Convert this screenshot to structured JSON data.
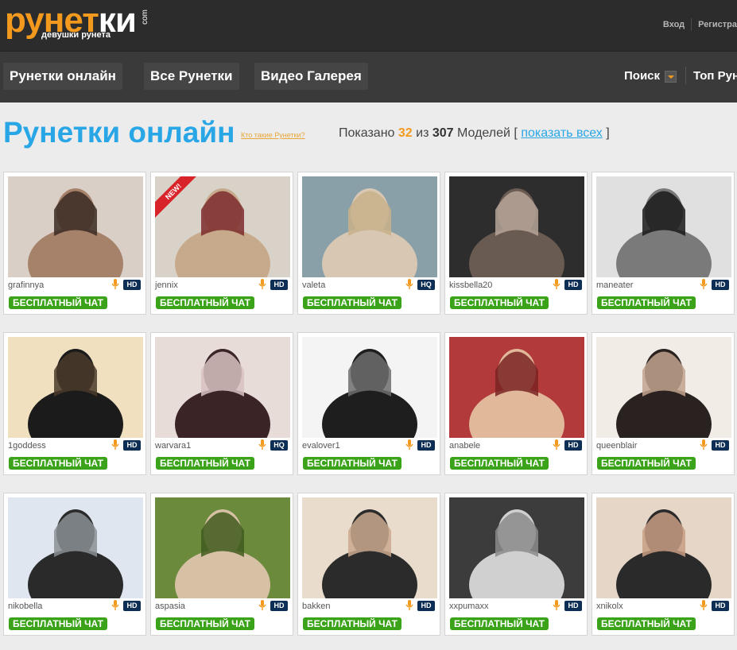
{
  "logo": {
    "main_orange": "рунет",
    "main_white": "ки",
    "domain": "com",
    "subtitle": "девушки рунета"
  },
  "auth": {
    "login": "Вход",
    "register": "Регистра"
  },
  "nav": {
    "items": [
      "Рунетки онлайн",
      "Все Рунетки",
      "Видео Галерея"
    ],
    "search": "Поиск",
    "top": "Топ Рун"
  },
  "heading": {
    "title": "Рунетки онлайн",
    "whois": "Кто такие Рунетки?"
  },
  "counter": {
    "prefix": "Показано",
    "shown": "32",
    "of": "из",
    "total": "307",
    "models": "Моделей [",
    "show_all": "показать всех",
    "close": "]"
  },
  "models": [
    {
      "name": "grafinnya",
      "quality": "HD",
      "chat": "БЕСПЛАТНЫЙ ЧАТ"
    },
    {
      "name": "jennix",
      "quality": "HD",
      "chat": "БЕСПЛАТНЫЙ ЧАТ",
      "new": "NEW!"
    },
    {
      "name": "valeta",
      "quality": "HQ",
      "chat": "БЕСПЛАТНЫЙ ЧАТ"
    },
    {
      "name": "kissbella20",
      "quality": "HD",
      "chat": "БЕСПЛАТНЫЙ ЧАТ"
    },
    {
      "name": "maneater",
      "quality": "HD",
      "chat": "БЕСПЛАТНЫЙ ЧАТ"
    },
    {
      "name": "1goddess",
      "quality": "HD",
      "chat": "БЕСПЛАТНЫЙ ЧАТ"
    },
    {
      "name": "warvara1",
      "quality": "HQ",
      "chat": "БЕСПЛАТНЫЙ ЧАТ"
    },
    {
      "name": "evalover1",
      "quality": "HD",
      "chat": "БЕСПЛАТНЫЙ ЧАТ"
    },
    {
      "name": "anabele",
      "quality": "HD",
      "chat": "БЕСПЛАТНЫЙ ЧАТ"
    },
    {
      "name": "queenblair",
      "quality": "HD",
      "chat": "БЕСПЛАТНЫЙ ЧАТ"
    },
    {
      "name": "nikobella",
      "quality": "HD",
      "chat": "БЕСПЛАТНЫЙ ЧАТ"
    },
    {
      "name": "aspasia",
      "quality": "HD",
      "chat": "БЕСПЛАТНЫЙ ЧАТ"
    },
    {
      "name": "bakken",
      "quality": "HD",
      "chat": "БЕСПЛАТНЫЙ ЧАТ"
    },
    {
      "name": "xxpumaxx",
      "quality": "HD",
      "chat": "БЕСПЛАТНЫЙ ЧАТ"
    },
    {
      "name": "xnikolx",
      "quality": "HD",
      "chat": "БЕСПЛАТНЫЙ ЧАТ"
    }
  ],
  "colors": {
    "accent_orange": "#f39a1e",
    "heading_blue": "#29a6e6",
    "chat_green": "#3aa319",
    "badge_navy": "#0d2e55"
  }
}
